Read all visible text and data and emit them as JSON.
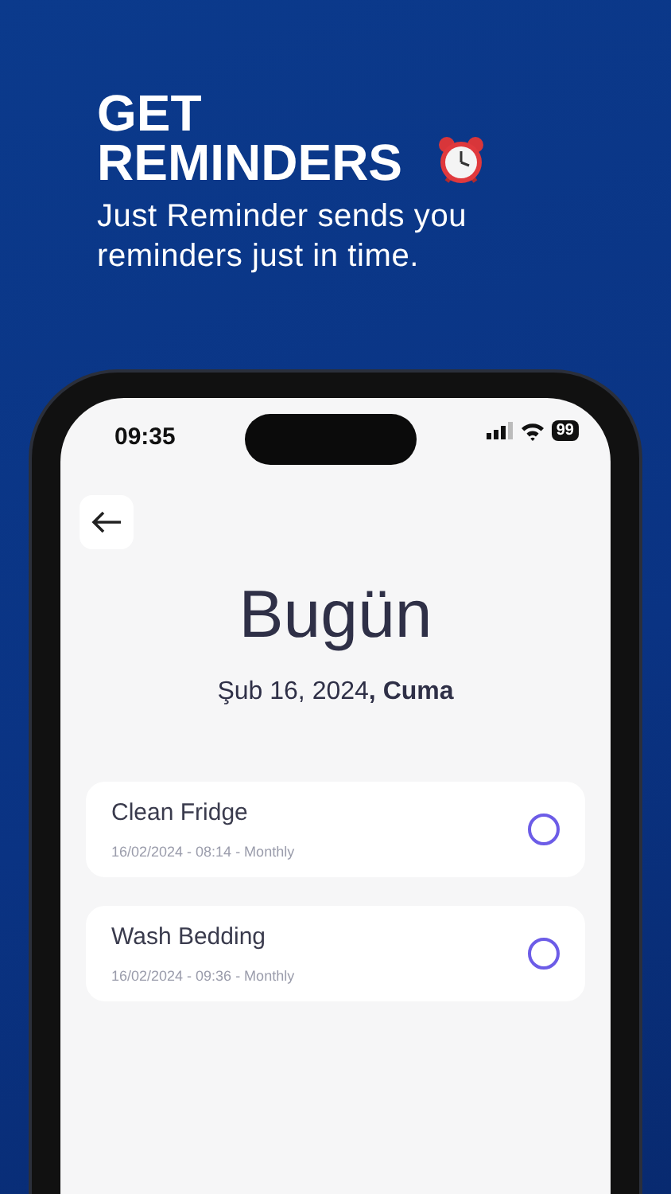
{
  "headline": {
    "title": "GET REMINDERS",
    "subtitle": "Just Reminder sends you reminders just in time."
  },
  "status_bar": {
    "time": "09:35",
    "battery": "99"
  },
  "screen": {
    "title": "Bugün",
    "date": "Şub 16, 2024",
    "weekday": ", Cuma",
    "reminders": [
      {
        "title": "Clean Fridge",
        "details": "16/02/2024 - 08:14 - Monthly",
        "checked": false
      },
      {
        "title": "Wash Bedding",
        "details": "16/02/2024 - 09:36 - Monthly",
        "checked": false
      }
    ]
  }
}
